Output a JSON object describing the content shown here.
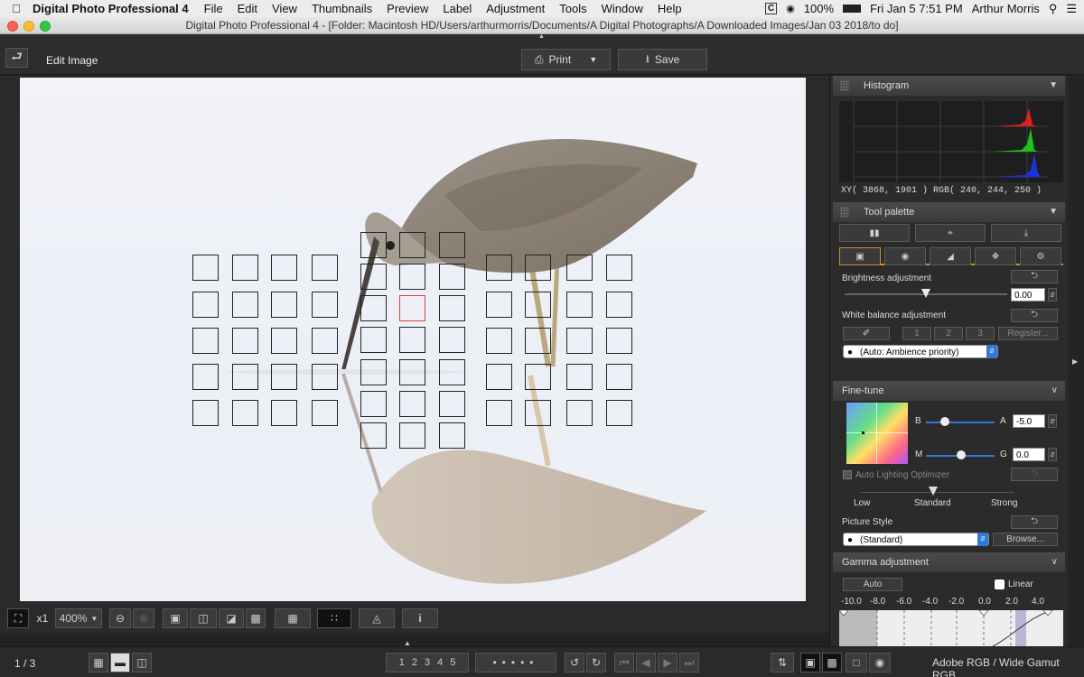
{
  "menubar": {
    "app_name": "Digital Photo Professional 4",
    "items": [
      "File",
      "Edit",
      "View",
      "Thumbnails",
      "Preview",
      "Label",
      "Adjustment",
      "Tools",
      "Window",
      "Help"
    ],
    "battery": "100%",
    "clock": "Fri Jan 5  7:51 PM",
    "user": "Arthur Morris"
  },
  "window": {
    "title": "Digital Photo Professional 4 - [Folder: Macintosh HD/Users/arthurmorris/Documents/A Digital Photographs/A Downloaded Images/Jan 03 2018/to do]"
  },
  "toolbar": {
    "mode_label": "Edit Image",
    "print_label": "Print",
    "save_label": "Save"
  },
  "viewbar": {
    "zoom_x1": "x1",
    "zoom_level": "400%"
  },
  "status": {
    "page": "1 / 3",
    "ratings": [
      "1",
      "2",
      "3",
      "4",
      "5"
    ],
    "color_space": "Adobe RGB / Wide Gamut RGB"
  },
  "histogram": {
    "title": "Histogram",
    "readout": "XY(  3868,   1901 ) RGB( 240,  244,  250 )"
  },
  "tool_palette": {
    "title": "Tool palette",
    "brightness_label": "Brightness adjustment",
    "brightness_value": "0.00",
    "brightness_level": 0.5,
    "wb_label": "White balance adjustment",
    "wb_presets": [
      "1",
      "2",
      "3"
    ],
    "register_label": "Register...",
    "wb_mode": "(Auto: Ambience priority)"
  },
  "fine_tune": {
    "title": "Fine-tune",
    "b_label": "B",
    "a_label": "A",
    "a_value": "-5.0",
    "m_label": "M",
    "g_label": "G",
    "g_value": "0.0",
    "alo_label": "Auto Lighting Optimizer",
    "alo_low": "Low",
    "alo_standard": "Standard",
    "alo_strong": "Strong",
    "picture_style_label": "Picture Style",
    "picture_style_value": "(Standard)",
    "browse_label": "Browse..."
  },
  "gamma": {
    "title": "Gamma adjustment",
    "auto_label": "Auto",
    "linear_label": "Linear",
    "scale": [
      "-10.0",
      "-8.0",
      "-6.0",
      "-4.0",
      "-2.0",
      "0.0",
      "2.0",
      "4.0"
    ]
  },
  "colors": {
    "af_selected": "#e0413a",
    "accent_blue": "#2f7ad6"
  }
}
